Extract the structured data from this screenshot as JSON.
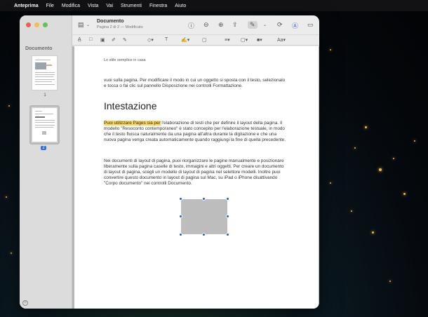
{
  "menubar": {
    "app": "Anteprima",
    "items": [
      "File",
      "Modifica",
      "Vista",
      "Vai",
      "Strumenti",
      "Finestra",
      "Aiuto"
    ]
  },
  "sidebar": {
    "title": "Documento",
    "thumbs": [
      {
        "label": "1"
      },
      {
        "label": "2"
      }
    ]
  },
  "toolbar": {
    "doc_title": "Documento",
    "doc_subtitle": "Pagina 2 di 2 — Modificato"
  },
  "page": {
    "header": "Lo stile semplice in casa",
    "para1": "vuoi sulla pagina. Per modificare il modo in cui un oggetto si sposta con il testo, selezionalo e tocca o fai clic sul pannello Disposizione nei controlli Formattazione.",
    "heading": "Intestazione",
    "para2_highlight": "Puoi utilizzare Pages sia per",
    "para2_rest": " l'elaborazione di testi che per definire il layout della pagina. Il modello \"Resoconto contemporaneo\" è stato concepito per l'elaborazione testuale, in modo che il testo fluisca naturalmente da una pagina all'altra durante la digitazione e che una nuova pagina venga creata automaticamente quando raggiungi la fine di quella precedente.",
    "para3": "Nei documenti di layout di pagina, puoi riorganizzare le pagine manualmente e posizionare liberamente sulla pagina caselle di testo, immagini e altri oggetti. Per creare un documento di layout di pagina, scegli un modello di layout di pagina nel selettore modelli. Inoltre puoi convertire questo documento in layout di pagina sul Mac, su iPad o iPhone disattivando \"Corpo documento\" nei controlli Documento."
  },
  "colors": {
    "highlight": "#f6d65b",
    "selection": "#1a5fe0"
  }
}
